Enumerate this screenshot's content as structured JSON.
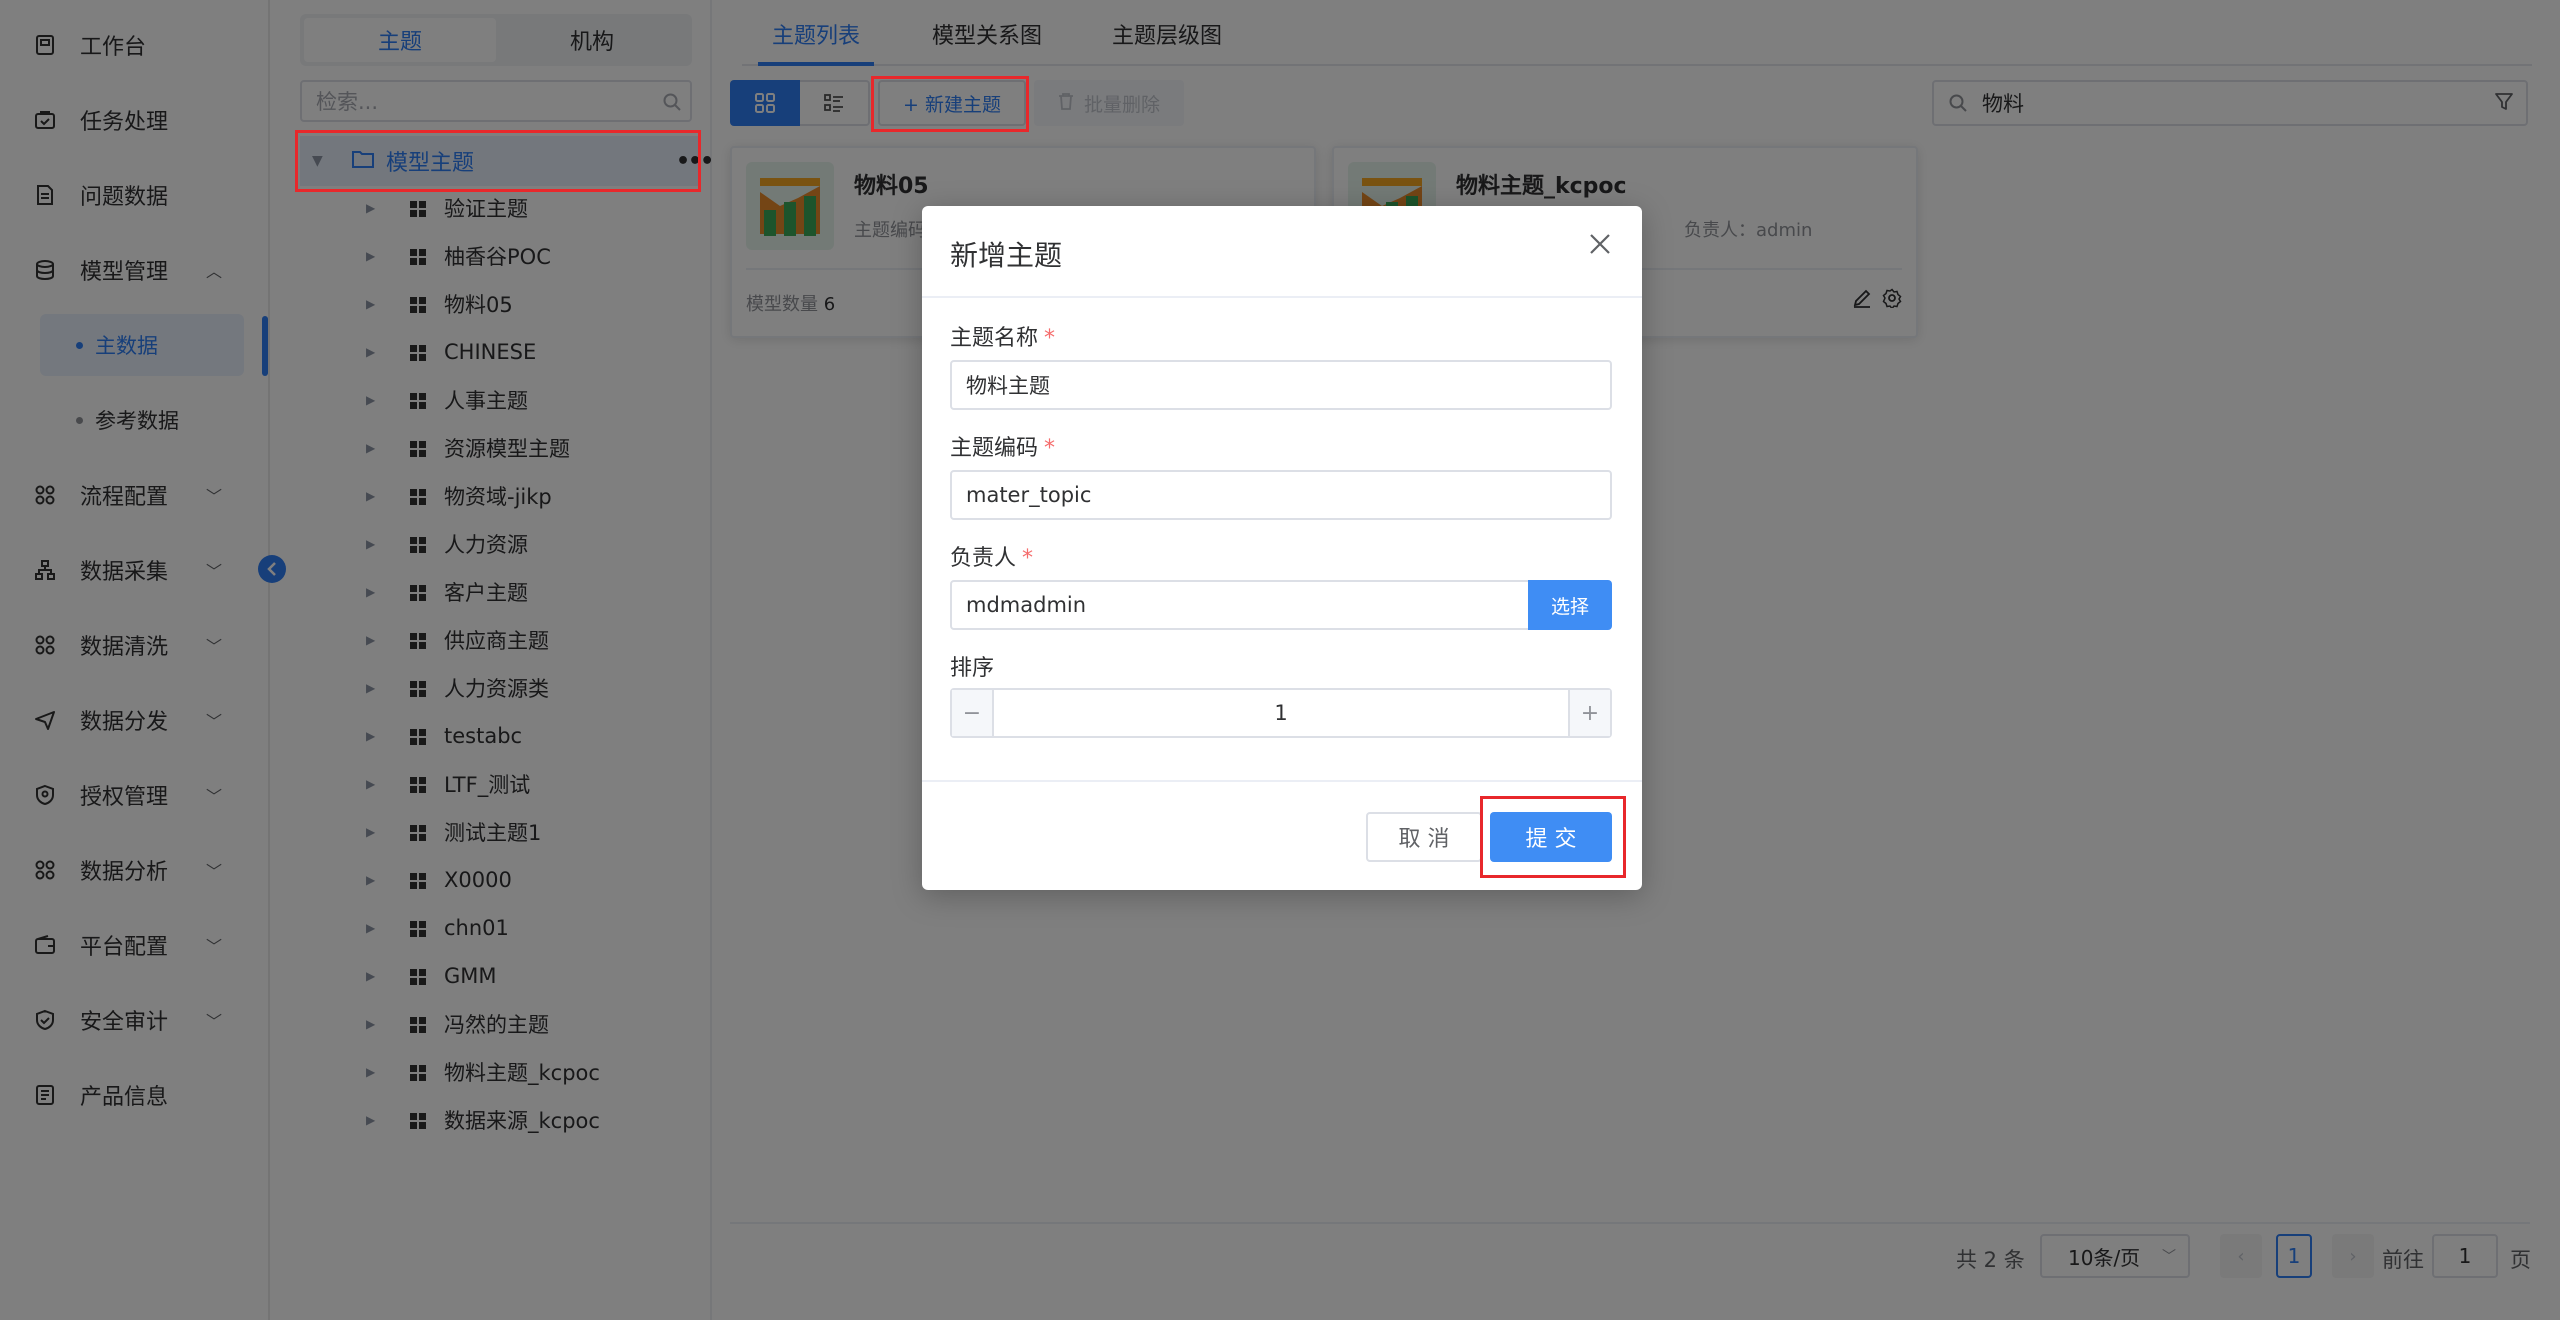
{
  "nav": {
    "items": [
      {
        "label": "工作台",
        "icon": "workbench-icon"
      },
      {
        "label": "任务处理",
        "icon": "task-icon"
      },
      {
        "label": "问题数据",
        "icon": "document-icon"
      },
      {
        "label": "模型管理",
        "icon": "database-icon"
      },
      {
        "label": "流程配置",
        "icon": "grid-icon"
      },
      {
        "label": "数据采集",
        "icon": "network-icon"
      },
      {
        "label": "数据清洗",
        "icon": "grid-icon"
      },
      {
        "label": "数据分发",
        "icon": "send-icon"
      },
      {
        "label": "授权管理",
        "icon": "shield-icon"
      },
      {
        "label": "数据分析",
        "icon": "grid-icon"
      },
      {
        "label": "平台配置",
        "icon": "wallet-icon"
      },
      {
        "label": "安全审计",
        "icon": "audit-shield-icon"
      },
      {
        "label": "产品信息",
        "icon": "info-doc-icon"
      }
    ],
    "sub_items": [
      {
        "label": "主数据"
      },
      {
        "label": "参考数据"
      }
    ]
  },
  "tree": {
    "segments": [
      "主题",
      "机构"
    ],
    "search_placeholder": "检索...",
    "root_label": "模型主题",
    "nodes": [
      "验证主题",
      "柚香谷POC",
      "物料05",
      "CHINESE",
      "人事主题",
      "资源模型主题",
      "物资域-jikp",
      "人力资源",
      "客户主题",
      "供应商主题",
      "人力资源类",
      "testabc",
      "LTF_测试",
      "测试主题1",
      "X0000",
      "chn01",
      "GMM",
      "冯然的主题",
      "物料主题_kcpoc",
      "数据来源_kcpoc"
    ]
  },
  "main": {
    "tabs": [
      "主题列表",
      "模型关系图",
      "主题层级图"
    ],
    "new_button": "+ 新建主题",
    "batch_delete": "批量删除",
    "search_value": "物料",
    "cards": [
      {
        "title": "物料05",
        "code_label": "主题编码",
        "count_label": "模型数量",
        "count": "6"
      },
      {
        "title": "物料主题_kcpoc",
        "owner_label": "负责人：admin"
      }
    ]
  },
  "pager": {
    "total": "共 2 条",
    "page_size": "10条/页",
    "current": "1",
    "goto_label": "前往",
    "goto_value": "1",
    "page_label": "页"
  },
  "modal": {
    "title": "新增主题",
    "fields": {
      "name_label": "主题名称",
      "name_value": "物料主题",
      "code_label": "主题编码",
      "code_value": "mater_topic",
      "owner_label": "负责人",
      "owner_value": "mdmadmin",
      "choose_button": "选择",
      "sort_label": "排序",
      "sort_value": "1"
    },
    "required_mark": "*",
    "cancel_button": "取 消",
    "submit_button": "提 交"
  },
  "colors": {
    "primary": "#2f7ef5",
    "highlight": "#e8282b"
  }
}
